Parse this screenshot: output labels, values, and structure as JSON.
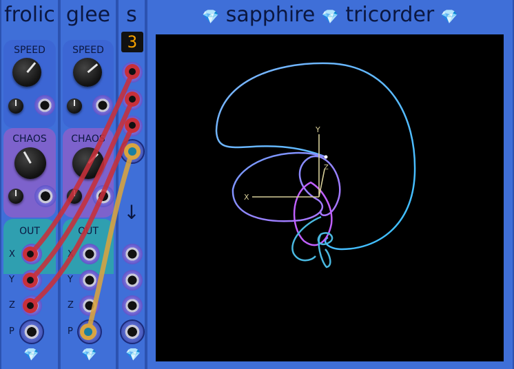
{
  "modules": {
    "frolic": {
      "title": "frolic",
      "speed_label": "SPEED",
      "chaos_label": "CHAOS",
      "out_label": "OUT",
      "ports": [
        "X",
        "Y",
        "Z",
        "P"
      ]
    },
    "glee": {
      "title": "glee",
      "speed_label": "SPEED",
      "chaos_label": "CHAOS",
      "out_label": "OUT",
      "ports": [
        "X",
        "Y",
        "Z",
        "P"
      ]
    },
    "s": {
      "title": "s",
      "display_value": "3",
      "arrow": "↓"
    },
    "tricorder": {
      "title_left": "sapphire",
      "title_right": "tricorder",
      "axis_x": "X",
      "axis_y": "Y",
      "axis_z": "Z"
    }
  },
  "colors": {
    "panel": "#3f6fd8",
    "speed_section": "#3c66d4",
    "chaos_section": "#7d62cc",
    "out_section": "#2f9fb0",
    "cable_red": "#c8303a",
    "cable_orange": "#d9a440",
    "display_digit": "#f4a000"
  },
  "icons": {
    "gem": "sapphire-gem-icon"
  }
}
